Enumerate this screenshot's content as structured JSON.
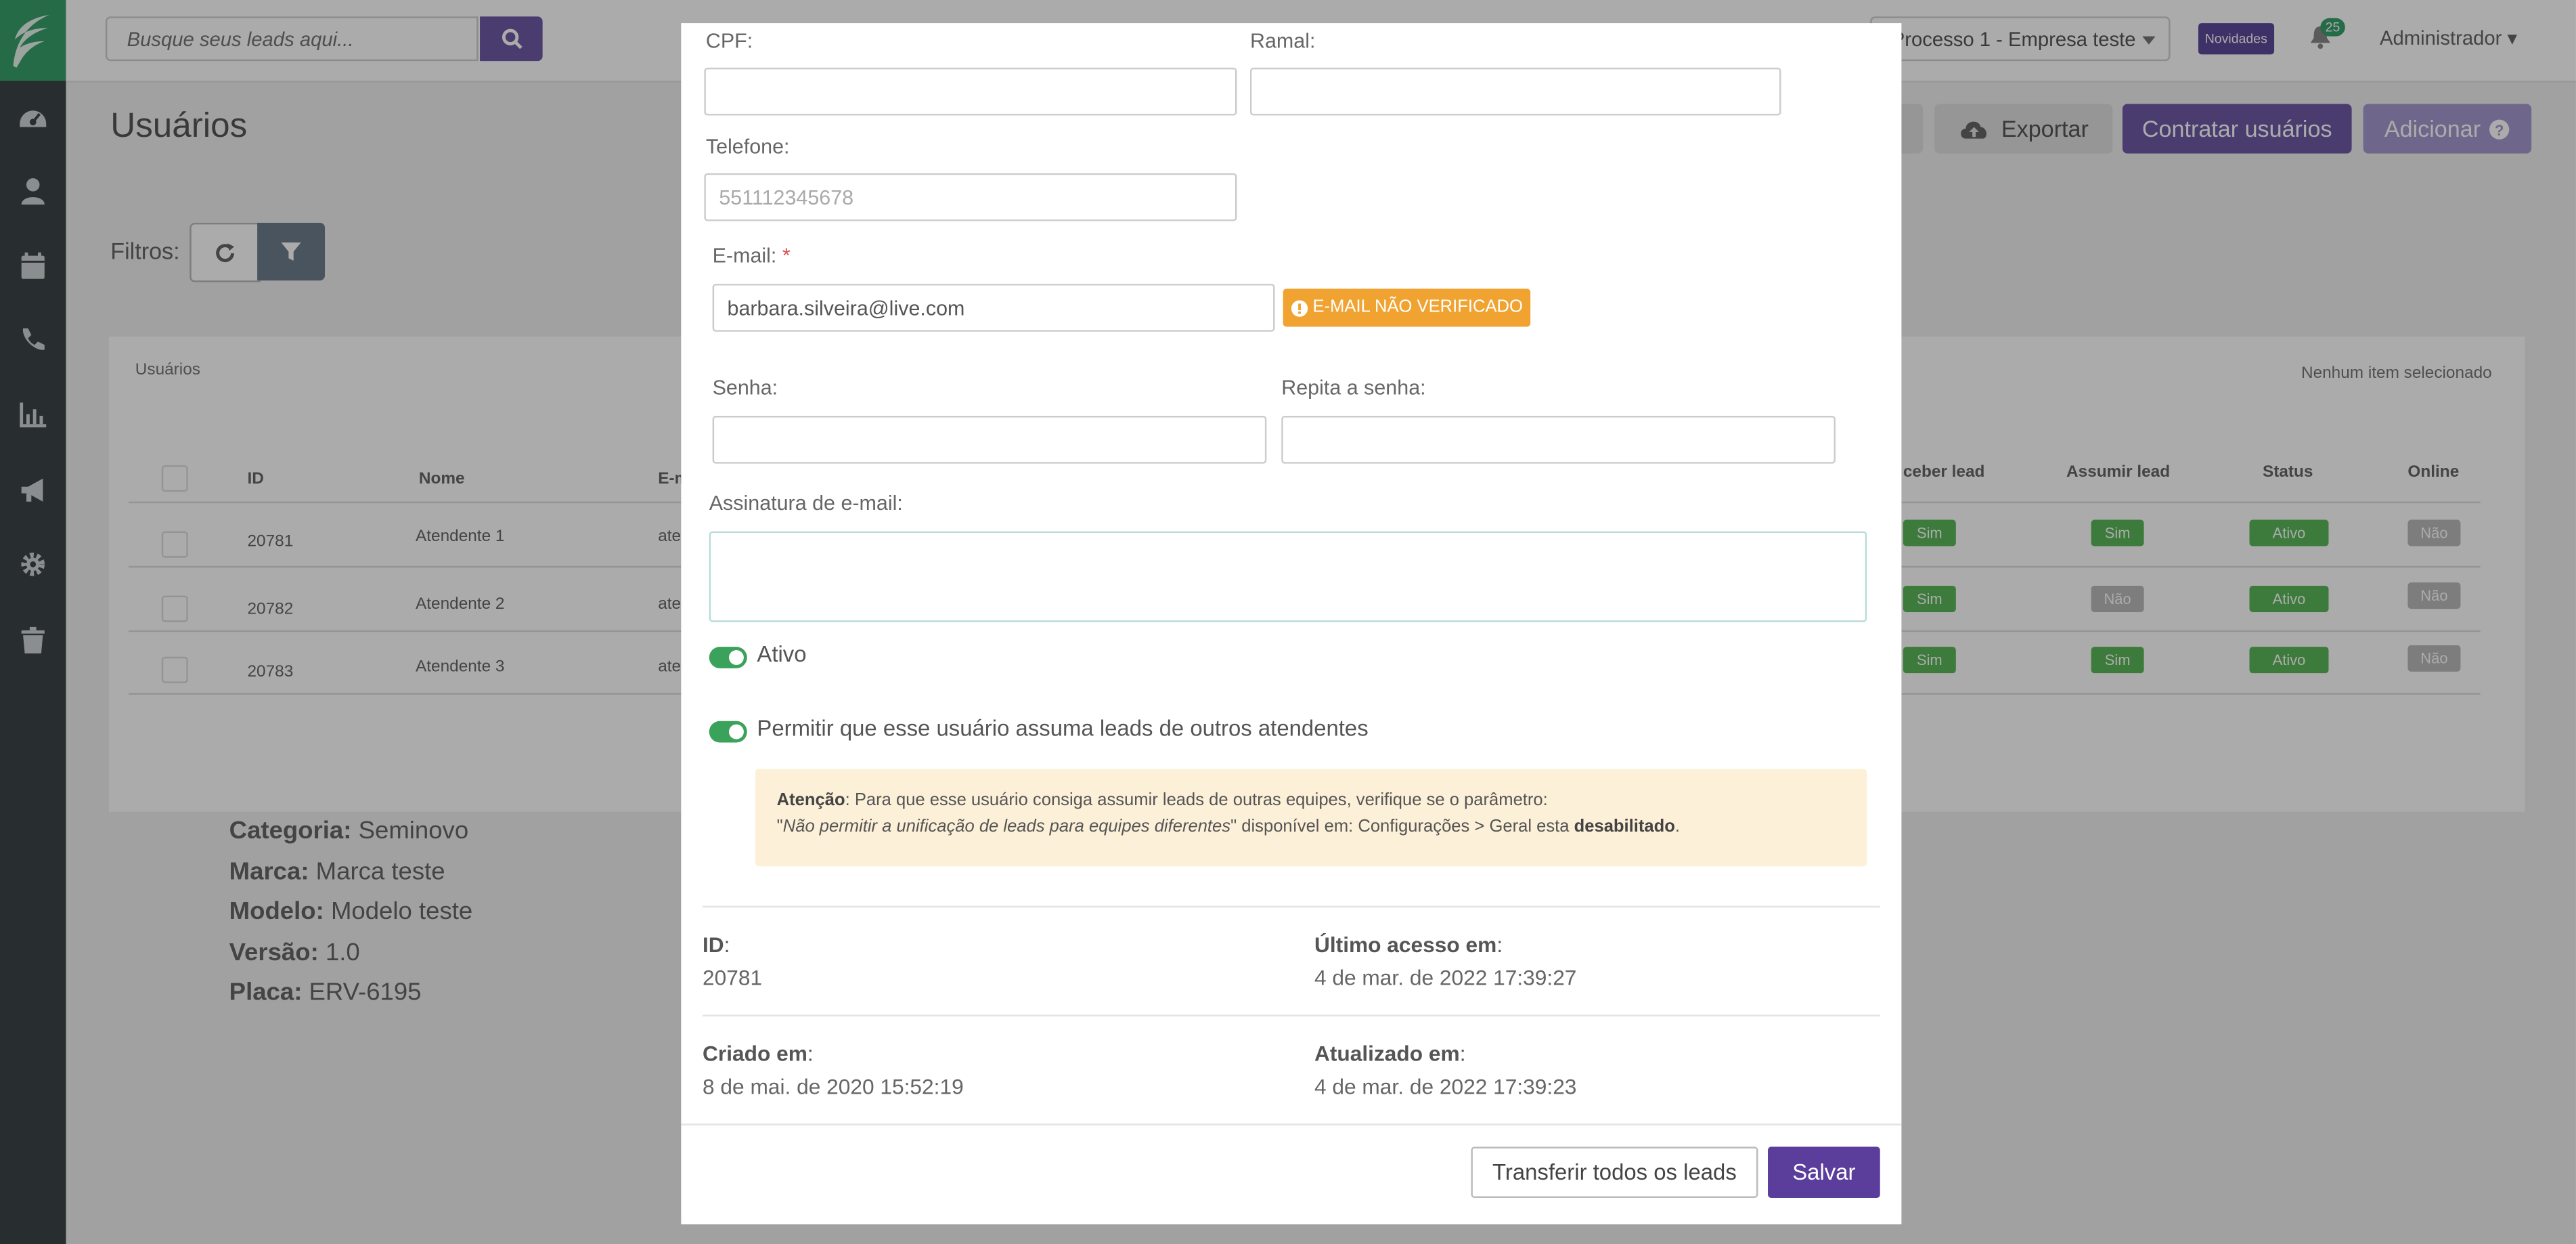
{
  "colors": {
    "sidebar": "#3d4447",
    "brand_green": "#39a06a",
    "primary_purple": "#6f5aa6",
    "save_purple": "#5b3d9b",
    "warning_orange": "#f0a330",
    "status_green": "#5cb85c"
  },
  "sidebar": {
    "items": [
      {
        "icon": "dashboard-icon"
      },
      {
        "icon": "user-icon"
      },
      {
        "icon": "calendar-icon"
      },
      {
        "icon": "phone-icon"
      },
      {
        "icon": "chart-icon"
      },
      {
        "icon": "megaphone-icon"
      },
      {
        "icon": "gear-icon"
      },
      {
        "icon": "trash-icon"
      }
    ]
  },
  "topbar": {
    "search_placeholder": "Busque seus leads aqui...",
    "process_select": "Processo 1 - Empresa teste",
    "novidades": "Novidades",
    "notification_count": "25",
    "user_menu": "Administrador"
  },
  "page": {
    "title": "Usuários",
    "exportar": "Exportar",
    "contratar": "Contratar usuários",
    "adicionar": "Adicionar",
    "filtros": "Filtros:"
  },
  "table": {
    "panel_title": "Usuários",
    "selection_status": "Nenhum item selecionado",
    "headers": {
      "id": "ID",
      "nome": "Nome",
      "email": "E-m",
      "receber": "ceber lead",
      "assumir": "Assumir lead",
      "status": "Status",
      "online": "Online"
    },
    "rows": [
      {
        "id": "20781",
        "nome": "Atendente 1",
        "email": "ate",
        "receber": "Sim",
        "assumir": "Sim",
        "status": "Ativo",
        "online": "Não"
      },
      {
        "id": "20782",
        "nome": "Atendente 2",
        "email": "ate",
        "receber": "Sim",
        "assumir": "Não",
        "status": "Ativo",
        "online": "Não"
      },
      {
        "id": "20783",
        "nome": "Atendente 3",
        "email": "ate",
        "receber": "Sim",
        "assumir": "Sim",
        "status": "Ativo",
        "online": "Não"
      }
    ]
  },
  "vehicle": {
    "categoria_key": "Categoria:",
    "categoria": "Seminovo",
    "marca_key": "Marca:",
    "marca": "Marca teste",
    "modelo_key": "Modelo:",
    "modelo": "Modelo teste",
    "versao_key": "Versão:",
    "versao": "1.0",
    "placa_key": "Placa:",
    "placa": "ERV-6195"
  },
  "modal": {
    "cpf_label": "CPF:",
    "cpf_value": "",
    "ramal_label": "Ramal:",
    "ramal_value": "",
    "telefone_label": "Telefone:",
    "telefone_placeholder": "551112345678",
    "email_label": "E-mail:",
    "email_required": "*",
    "email_value": "barbara.silveira@live.com",
    "email_badge": "E-MAIL NÃO VERIFICADO",
    "senha_label": "Senha:",
    "repita_label": "Repita a senha:",
    "assinatura_label": "Assinatura de e-mail:",
    "ativo_label": "Ativo",
    "ativo_on": true,
    "permitir_label": "Permitir que esse usuário assuma leads de outros atendentes",
    "permitir_on": true,
    "alert": {
      "title": "Atenção",
      "line1": ": Para que esse usuário consiga assumir leads de outras equipes, verifique se o parâmetro:",
      "quote_open": "\"",
      "param": "Não permitir a unificação de leads para equipes diferentes",
      "line2": "\" disponível em: Configurações > Geral esta ",
      "state": "desabilitado",
      "end": "."
    },
    "meta": {
      "id_key": "ID",
      "id_value": "20781",
      "ultimo_key": "Último acesso em",
      "ultimo_value": "4 de mar. de 2022 17:39:27",
      "criado_key": "Criado em",
      "criado_value": "8 de mai. de 2020 15:52:19",
      "atualizado_key": "Atualizado em",
      "atualizado_value": "4 de mar. de 2022 17:39:23",
      "colon": ":"
    },
    "transfer_button": "Transferir todos os leads",
    "save_button": "Salvar"
  }
}
